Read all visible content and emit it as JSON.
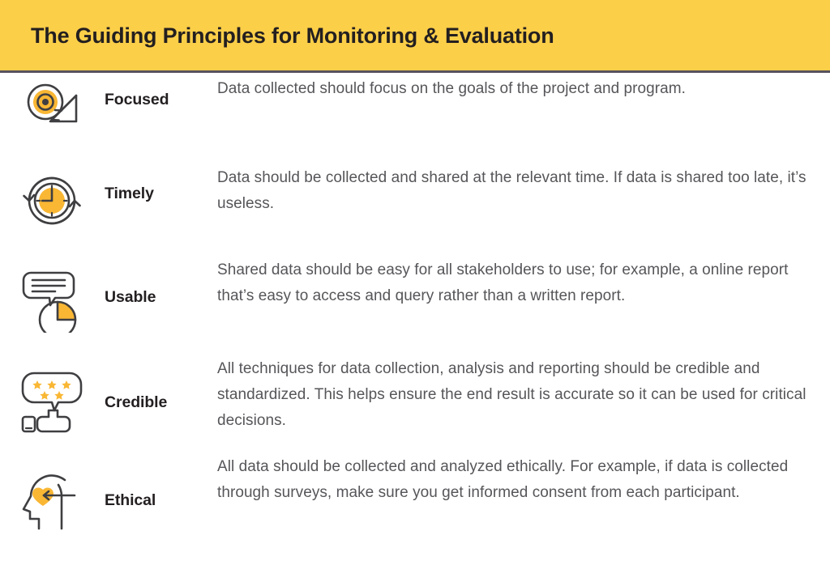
{
  "header": {
    "title": "The Guiding Principles for Monitoring & Evaluation",
    "background_color": "#fccf49",
    "title_color": "#231f20",
    "rule_color": "#57525e"
  },
  "theme": {
    "accent_yellow": "#f9b734",
    "icon_stroke": "#3f3f42",
    "body_text": "#56565a",
    "label_text": "#231f20",
    "page_background": "#ffffff"
  },
  "principles": [
    {
      "icon": "target-bow-arrow-icon",
      "label": "Focused",
      "description": "Data collected should focus on the goals of the project and program."
    },
    {
      "icon": "clock-refresh-icon",
      "label": "Timely",
      "description": "Data should be collected and shared at the relevant time. If data is shared too late, it’s useless."
    },
    {
      "icon": "speech-bubble-pie-chart-icon",
      "label": "Usable",
      "description": "Shared data should be easy for all stakeholders to use; for example, a online report that’s easy to access and query rather than a written report."
    },
    {
      "icon": "thumbs-up-stars-icon",
      "label": "Credible",
      "description": "All techniques for data collection, analysis and reporting should be credible and standardized. This helps ensure the end result is accurate so it can be used for critical decisions."
    },
    {
      "icon": "head-heart-arrow-icon",
      "label": "Ethical",
      "description": "All data should be collected and analyzed ethically. For example, if data is collected through surveys, make sure you get informed consent from each participant."
    }
  ]
}
